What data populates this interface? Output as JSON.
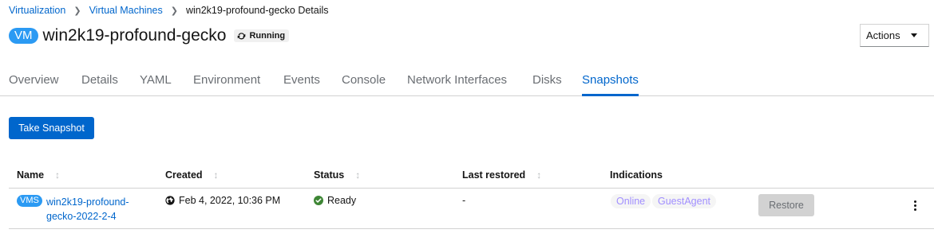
{
  "breadcrumb": {
    "items": [
      "Virtualization",
      "Virtual Machines"
    ],
    "current": "win2k19-profound-gecko Details"
  },
  "header": {
    "badge": "VM",
    "title": "win2k19-profound-gecko",
    "status": "Running",
    "actions_label": "Actions"
  },
  "tabs": [
    {
      "label": "Overview"
    },
    {
      "label": "Details"
    },
    {
      "label": "YAML"
    },
    {
      "label": "Environment"
    },
    {
      "label": "Events"
    },
    {
      "label": "Console"
    },
    {
      "label": "Network Interfaces"
    },
    {
      "label": "Disks"
    },
    {
      "label": "Snapshots",
      "active": true
    }
  ],
  "toolbar": {
    "take_snapshot_label": "Take Snapshot"
  },
  "table": {
    "columns": [
      "Name",
      "Created",
      "Status",
      "Last restored",
      "Indications"
    ],
    "rows": [
      {
        "badge": "VMS",
        "name_line1": "win2k19-profound-",
        "name_line2": "gecko-2022-2-4",
        "created": "Feb 4, 2022, 10:36 PM",
        "status": "Ready",
        "last_restored": "-",
        "indications": [
          "Online",
          "GuestAgent"
        ],
        "restore_label": "Restore"
      }
    ]
  },
  "colors": {
    "accent": "#0066cc",
    "badge": "#2b9af3",
    "success": "#3e8635",
    "indication_text": "#a18fff"
  },
  "icons": {
    "status": "sync-icon",
    "created": "globe-icon",
    "ready": "check-circle-icon",
    "sort": "sort-icon",
    "menu": "kebab-icon"
  }
}
